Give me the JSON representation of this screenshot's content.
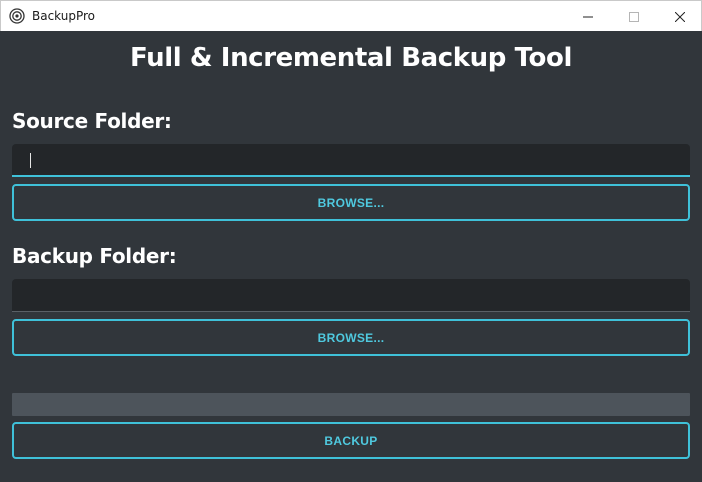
{
  "window": {
    "title": "BackupPro",
    "minimize_glyph": "—",
    "maximize_glyph": "☐",
    "close_glyph": "✕"
  },
  "main": {
    "heading": "Full & Incremental Backup Tool",
    "source": {
      "label": "Source Folder:",
      "value": "",
      "browse_label": "BROWSE..."
    },
    "backup": {
      "label": "Backup Folder:",
      "value": "",
      "browse_label": "BROWSE..."
    },
    "progress": {
      "value": 0
    },
    "backup_button_label": "BACKUP"
  },
  "colors": {
    "background": "#31363b",
    "field": "#232629",
    "accent": "#3fc1d9",
    "progress_track": "#4d545b"
  }
}
